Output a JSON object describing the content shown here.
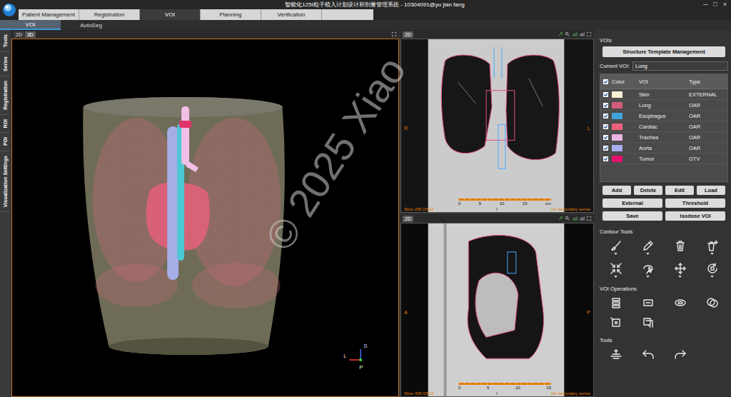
{
  "window": {
    "title": "智能化125I粒子植入计划设计和剂量管理系统 - 10304091@yu jian fang",
    "controls": [
      "─",
      "□",
      "×"
    ]
  },
  "tabs": [
    {
      "label": "Patient Management",
      "selected": false
    },
    {
      "label": "Registration",
      "selected": false
    },
    {
      "label": "VOI",
      "selected": true
    },
    {
      "label": "Planning",
      "selected": false
    },
    {
      "label": "Verification",
      "selected": false
    }
  ],
  "subtabs": [
    {
      "label": "VOI",
      "selected": true
    },
    {
      "label": "AutoSeg",
      "selected": false
    }
  ],
  "side_tabs": [
    "Tools",
    "Series",
    "Registration",
    "ROI",
    "POI",
    "Visualization Settings"
  ],
  "view3d": {
    "modes": [
      {
        "label": "2D",
        "selected": false
      },
      {
        "label": "3D",
        "selected": true
      }
    ],
    "axes": {
      "up": "S",
      "left": "L",
      "toward": "P"
    }
  },
  "views2d": [
    {
      "kind": "coronal",
      "mode": "2D",
      "slice": "Slice 295.0/512",
      "secondary": "No secondary series",
      "left": "R",
      "right": "L",
      "bottom": "I",
      "ticks": [
        "0",
        "5",
        "10",
        "15",
        "cm"
      ]
    },
    {
      "kind": "sagittal",
      "mode": "2D",
      "slice": "Slice 305.0/512",
      "secondary": "No secondary series",
      "left": "A",
      "right": "P",
      "bottom": "I",
      "ticks": [
        "0",
        "5",
        "10",
        "15"
      ]
    }
  ],
  "watermark": "© 2025 Xiao",
  "panel": {
    "title": "VOIs",
    "template_button": "Structure Template Management",
    "current_label": "Current VOI:",
    "current_value": "Lung",
    "columns": {
      "color": "Color",
      "color_checked": true,
      "voi": "VOI",
      "type": "Type"
    },
    "rows": [
      {
        "name": "Skin",
        "type": "EXTERNAL",
        "checked": true,
        "color": "#f7efd2"
      },
      {
        "name": "Lung",
        "type": "OAR",
        "checked": true,
        "color": "#d35c7c"
      },
      {
        "name": "Esophagus",
        "type": "OAR",
        "checked": true,
        "color": "#3fa4d8"
      },
      {
        "name": "Cardiac",
        "type": "OAR",
        "checked": true,
        "color": "#f0607e"
      },
      {
        "name": "Trachea",
        "type": "OAR",
        "checked": true,
        "color": "#e9b5e7"
      },
      {
        "name": "Aorta",
        "type": "OAR",
        "checked": true,
        "color": "#a8aef0"
      },
      {
        "name": "Tumor",
        "type": "GTV",
        "checked": true,
        "color": "#e3136c"
      }
    ],
    "buttons": [
      [
        "Add",
        "Delete",
        "Edit",
        "Load"
      ],
      [
        "External",
        "Threshold"
      ],
      [
        "Save",
        "Isodose VOI"
      ]
    ],
    "sections": {
      "contour": "Contour Tools",
      "operations": "VOI Operations",
      "tools": "Tools"
    }
  }
}
